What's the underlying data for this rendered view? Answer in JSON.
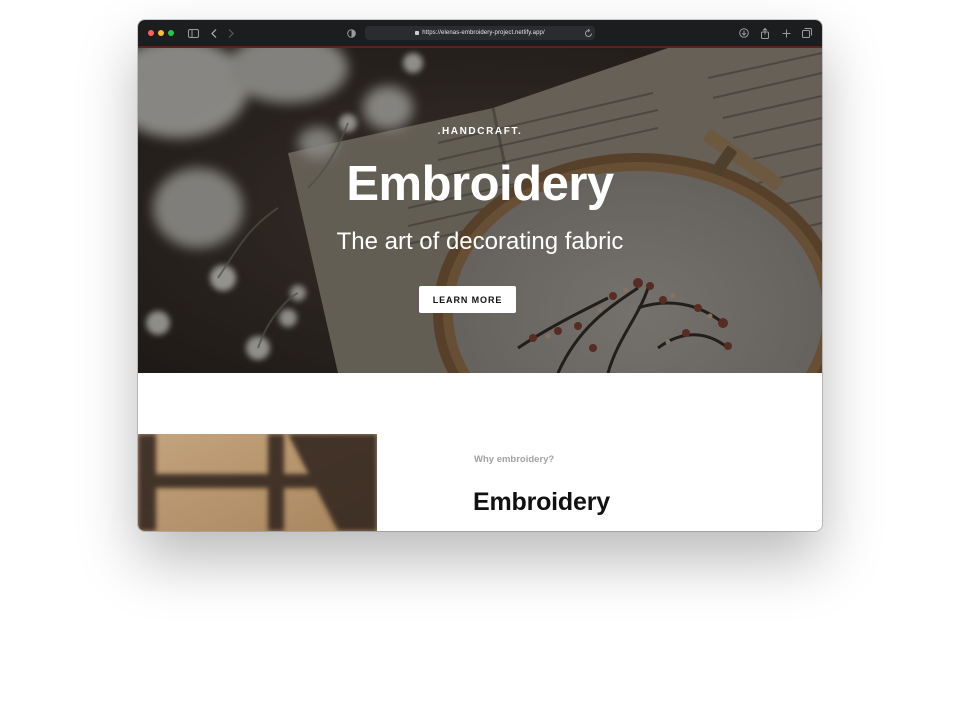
{
  "browser": {
    "url": "https://elenas-embroidery-project.netlify.app/"
  },
  "hero": {
    "eyebrow": ".HANDCRAFT.",
    "title": "Embroidery",
    "subtitle": "The art of decorating fabric",
    "button_label": "LEARN MORE"
  },
  "about": {
    "label": "Why embroidery?",
    "title": "Embroidery"
  },
  "colors": {
    "titlebar": "#1c1d1f",
    "accent_line": "#5a2418",
    "traffic_red": "#ff5f57",
    "traffic_yellow": "#febc2e",
    "traffic_green": "#28c840",
    "button_bg": "#ffffff",
    "label_gray": "#a3a3a3"
  },
  "icons": [
    "sidebar-icon",
    "back-icon",
    "forward-icon",
    "shield-icon",
    "lock-icon",
    "reload-icon",
    "download-icon",
    "share-icon",
    "new-tab-icon",
    "tabs-icon"
  ]
}
